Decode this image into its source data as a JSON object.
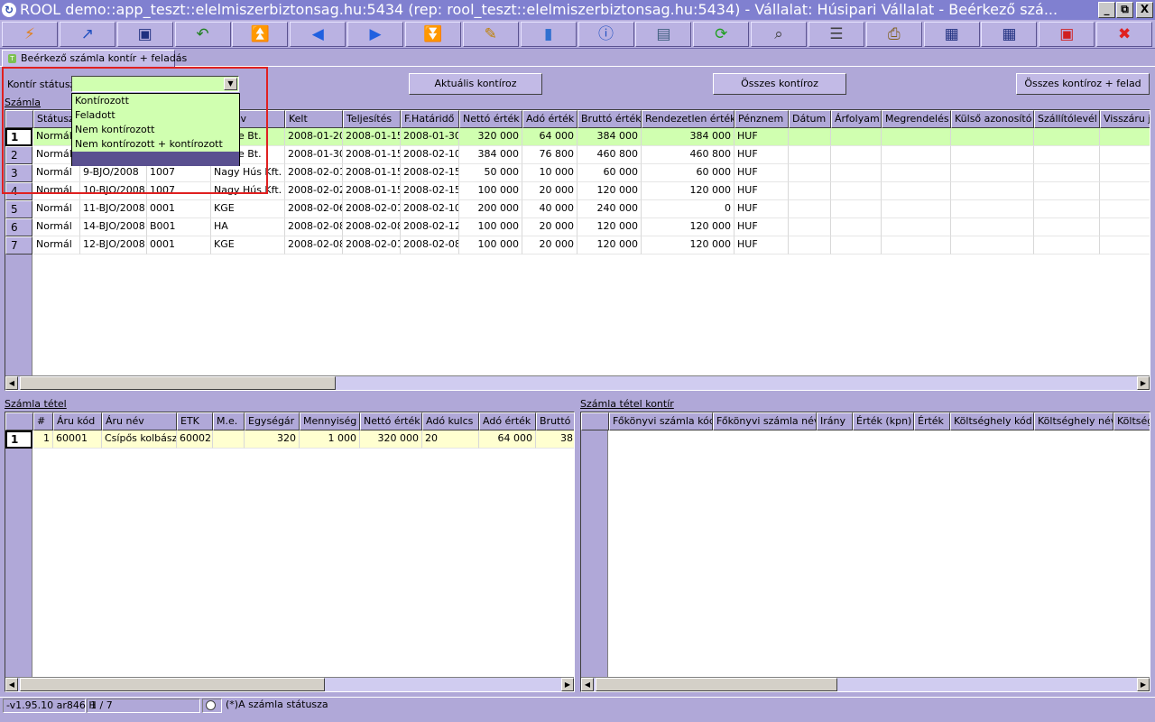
{
  "title": "ROOL demo::app_teszt::elelmiszerbiztonsag.hu:5434 (rep: rool_teszt::elelmiszerbiztonsag.hu:5434) - Vállalat: Húsipari Vállalat - Beérkező szá...",
  "window_controls": {
    "minimize": "_",
    "restore": "⧉",
    "close": "X"
  },
  "toolbar": [
    {
      "icon": "bolt-icon",
      "glyph": "⚡",
      "color": "#e08020"
    },
    {
      "icon": "open-folder-icon",
      "glyph": "↗",
      "color": "#2050c0"
    },
    {
      "icon": "save-icon",
      "glyph": "▣",
      "color": "#203080"
    },
    {
      "icon": "undo-arrow-icon",
      "glyph": "↶",
      "color": "#208020"
    },
    {
      "icon": "first-record-icon",
      "glyph": "⏫",
      "color": "#2060e0"
    },
    {
      "icon": "previous-record-icon",
      "glyph": "◀",
      "color": "#2060e0"
    },
    {
      "icon": "next-record-icon",
      "glyph": "▶",
      "color": "#2060e0"
    },
    {
      "icon": "last-record-icon",
      "glyph": "⏬",
      "color": "#2060e0"
    },
    {
      "icon": "edit-icon",
      "glyph": "✎",
      "color": "#c08000"
    },
    {
      "icon": "database-icon",
      "glyph": "▮",
      "color": "#3070d0"
    },
    {
      "icon": "info-icon",
      "glyph": "ⓘ",
      "color": "#2050c0"
    },
    {
      "icon": "form-view-icon",
      "glyph": "▤",
      "color": "#406080"
    },
    {
      "icon": "refresh-icon",
      "glyph": "⟳",
      "color": "#20a020"
    },
    {
      "icon": "search-icon",
      "glyph": "⌕",
      "color": "#404040"
    },
    {
      "icon": "filter-icon",
      "glyph": "☰",
      "color": "#404040"
    },
    {
      "icon": "print-icon",
      "glyph": "⎙",
      "color": "#806020"
    },
    {
      "icon": "grid-export-icon",
      "glyph": "▦",
      "color": "#203080"
    },
    {
      "icon": "grid-import-icon",
      "glyph": "▦",
      "color": "#203080"
    },
    {
      "icon": "fullscreen-icon",
      "glyph": "▣",
      "color": "#d02020"
    },
    {
      "icon": "close-icon",
      "glyph": "✖",
      "color": "#e02020"
    }
  ],
  "tab": {
    "label": "Beérkező számla kontír + feladás"
  },
  "filter": {
    "label": "Kontír státusz:",
    "value": ""
  },
  "dropdown_options": [
    "Kontírozott",
    "Feladott",
    "Nem kontírozott",
    "Nem kontírozott + kontírozott",
    ""
  ],
  "buttons": {
    "current": "Aktuális kontíroz",
    "all": "Összes kontíroz",
    "all_send": "Összes kontíroz + felad"
  },
  "invoice": {
    "title": "Számla",
    "headers": [
      "Státusz",
      "",
      "",
      "er név",
      "Kelt",
      "Teljesítés",
      "F.Határidő",
      "Nettó érték",
      "Adó érték",
      "Bruttó érték",
      "Rendezetlen érték",
      "Pénznem",
      "Dátum",
      "Árfolyam",
      "Megrendelés",
      "Külső azonosító",
      "Szállítólevél",
      "Visszáru je"
    ],
    "rows": [
      {
        "num": "1",
        "cells": [
          "Normál",
          "",
          "",
          "Csirke Bt.",
          "2008-01-20",
          "2008-01-15",
          "2008-01-30",
          "320 000",
          "64 000",
          "384 000",
          "384 000",
          "HUF",
          "",
          "",
          "",
          "",
          "",
          ""
        ]
      },
      {
        "num": "2",
        "cells": [
          "Normál",
          "",
          "",
          "Csirke Bt.",
          "2008-01-30",
          "2008-01-15",
          "2008-02-10",
          "384 000",
          "76 800",
          "460 800",
          "460 800",
          "HUF",
          "",
          "",
          "",
          "",
          "",
          ""
        ]
      },
      {
        "num": "3",
        "cells": [
          "Normál",
          "9-BJO/2008",
          "1007",
          "Nagy Hús Kft.",
          "2008-02-01",
          "2008-01-15",
          "2008-02-15",
          "50 000",
          "10 000",
          "60 000",
          "60 000",
          "HUF",
          "",
          "",
          "",
          "",
          "",
          ""
        ]
      },
      {
        "num": "4",
        "cells": [
          "Normál",
          "10-BJO/2008",
          "1007",
          "Nagy Hús Kft.",
          "2008-02-02",
          "2008-01-15",
          "2008-02-15",
          "100 000",
          "20 000",
          "120 000",
          "120 000",
          "HUF",
          "",
          "",
          "",
          "",
          "",
          ""
        ]
      },
      {
        "num": "5",
        "cells": [
          "Normál",
          "11-BJO/2008",
          "0001",
          "KGE",
          "2008-02-06",
          "2008-02-01",
          "2008-02-10",
          "200 000",
          "40 000",
          "240 000",
          "0",
          "HUF",
          "",
          "",
          "",
          "",
          "",
          ""
        ]
      },
      {
        "num": "6",
        "cells": [
          "Normál",
          "14-BJO/2008",
          "B001",
          "HA",
          "2008-02-08",
          "2008-02-08",
          "2008-02-12",
          "100 000",
          "20 000",
          "120 000",
          "120 000",
          "HUF",
          "",
          "",
          "",
          "",
          "",
          ""
        ]
      },
      {
        "num": "7",
        "cells": [
          "Normál",
          "12-BJO/2008",
          "0001",
          "KGE",
          "2008-02-08",
          "2008-02-01",
          "2008-02-08",
          "100 000",
          "20 000",
          "120 000",
          "120 000",
          "HUF",
          "",
          "",
          "",
          "",
          "",
          ""
        ]
      }
    ]
  },
  "item": {
    "title": "Számla tétel",
    "headers": [
      "#",
      "Áru kód",
      "Áru név",
      "ETK",
      "M.e.",
      "Egységár",
      "Mennyiség",
      "Nettó érték",
      "Adó kulcs",
      "Adó érték",
      "Bruttó é"
    ],
    "rows": [
      {
        "num": "1",
        "cells": [
          "1",
          "60001",
          "Csípős kolbász",
          "60002",
          "",
          "320",
          "1 000",
          "320 000",
          "20",
          "64 000",
          "38"
        ]
      }
    ]
  },
  "account": {
    "title": "Számla tétel kontír",
    "headers": [
      "Főkönyvi számla kód",
      "Főkönyvi számla név",
      "Irány",
      "Érték (kpn)",
      "Érték",
      "Költséghely kód",
      "Költséghely név",
      "Költség"
    ]
  },
  "status": {
    "version": "-v1.95.10 ar846 H",
    "position": "1 / 7",
    "message": "(*)A számla státusza"
  },
  "colors": {
    "selected_row": "#d0ffb0",
    "item_row": "#ffffd0",
    "highlight": "#e02020"
  }
}
